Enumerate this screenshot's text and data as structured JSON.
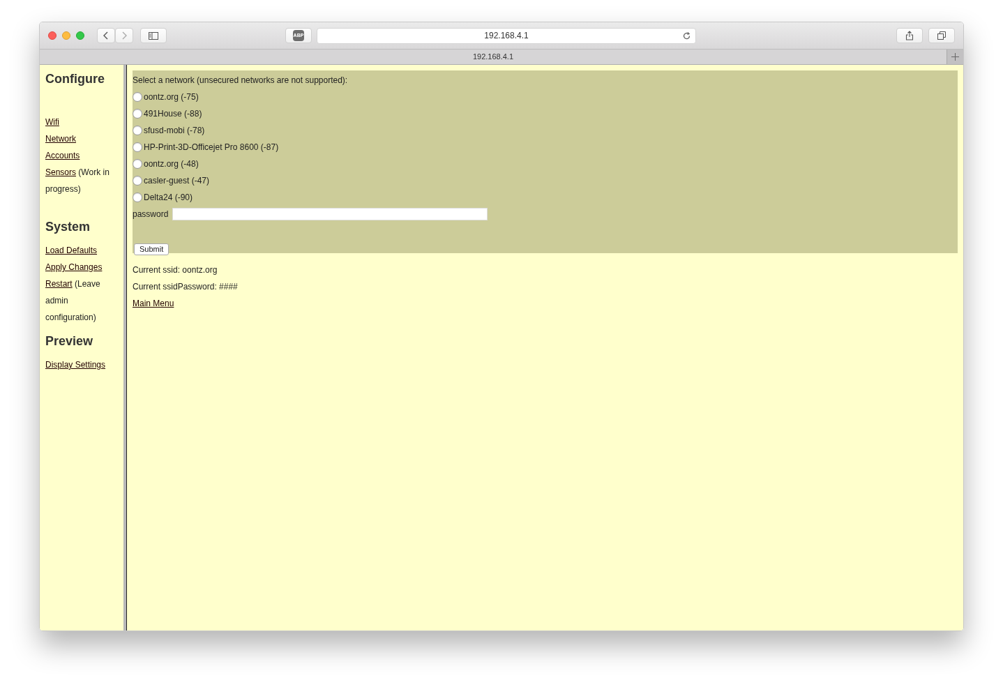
{
  "browser": {
    "adblock_label": "ABP",
    "url": "192.168.4.1",
    "tab_title": "192.168.4.1"
  },
  "sidebar": {
    "sections": [
      {
        "title": "Configure",
        "items": [
          {
            "link": "Wifi"
          },
          {
            "link": "Network"
          },
          {
            "link": "Accounts"
          },
          {
            "link": "Sensors",
            "note": "(Work in progress)"
          }
        ]
      },
      {
        "title": "System",
        "items": [
          {
            "link": "Load Defaults"
          },
          {
            "link": "Apply Changes"
          },
          {
            "link": "Restart",
            "note": "(Leave admin configuration)"
          }
        ]
      },
      {
        "title": "Preview",
        "items": [
          {
            "link": "Display Settings"
          }
        ]
      }
    ]
  },
  "form": {
    "prompt": "Select a network (unsecured networks are not supported):",
    "networks": [
      {
        "label": "oontz.org (-75)",
        "selected": false
      },
      {
        "label": "491House (-88)",
        "selected": false
      },
      {
        "label": "sfusd-mobi (-78)",
        "selected": false
      },
      {
        "label": "HP-Print-3D-Officejet Pro 8600 (-87)",
        "selected": false
      },
      {
        "label": "oontz.org (-48)",
        "selected": false
      },
      {
        "label": "casler-guest (-47)",
        "selected": false
      },
      {
        "label": "Delta24 (-90)",
        "selected": false
      }
    ],
    "password_label": "password",
    "submit": "Submit"
  },
  "status": [
    "Current ssid: oontz.org",
    "Current ssidPassword: ####"
  ],
  "main_menu": "Main Menu"
}
